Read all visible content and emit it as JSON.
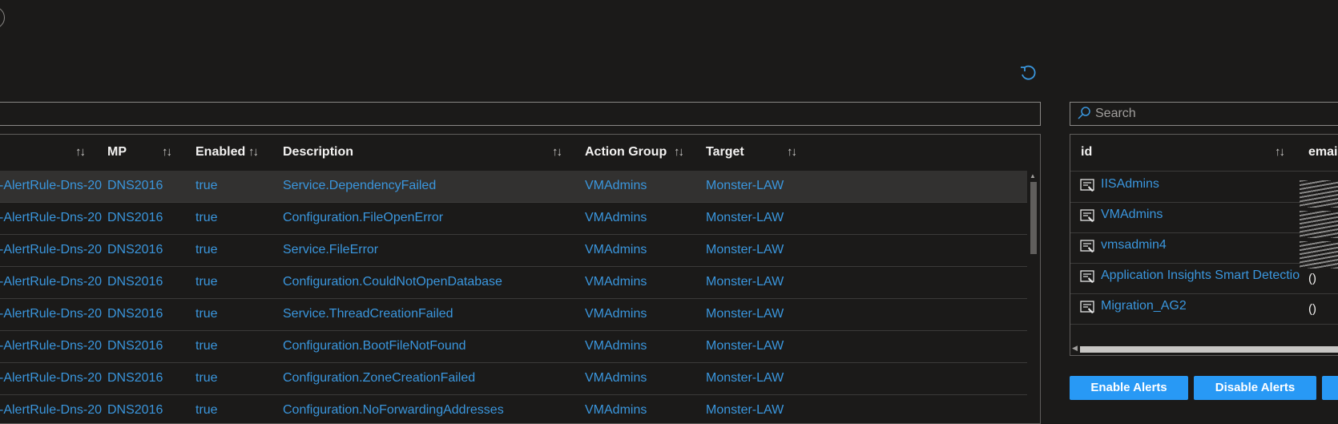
{
  "left_table": {
    "columns": [
      "",
      "MP",
      "Enabled",
      "Description",
      "Action Group",
      "Target"
    ],
    "rows": [
      {
        "name": "-AlertRule-Dns-20",
        "mp": "DNS2016",
        "enabled": "true",
        "description": "Service.DependencyFailed",
        "action_group": "VMAdmins",
        "target": "Monster-LAW"
      },
      {
        "name": "-AlertRule-Dns-20",
        "mp": "DNS2016",
        "enabled": "true",
        "description": "Configuration.FileOpenError",
        "action_group": "VMAdmins",
        "target": "Monster-LAW"
      },
      {
        "name": "-AlertRule-Dns-20",
        "mp": "DNS2016",
        "enabled": "true",
        "description": "Service.FileError",
        "action_group": "VMAdmins",
        "target": "Monster-LAW"
      },
      {
        "name": "-AlertRule-Dns-20",
        "mp": "DNS2016",
        "enabled": "true",
        "description": "Configuration.CouldNotOpenDatabase",
        "action_group": "VMAdmins",
        "target": "Monster-LAW"
      },
      {
        "name": "-AlertRule-Dns-20",
        "mp": "DNS2016",
        "enabled": "true",
        "description": "Service.ThreadCreationFailed",
        "action_group": "VMAdmins",
        "target": "Monster-LAW"
      },
      {
        "name": "-AlertRule-Dns-20",
        "mp": "DNS2016",
        "enabled": "true",
        "description": "Configuration.BootFileNotFound",
        "action_group": "VMAdmins",
        "target": "Monster-LAW"
      },
      {
        "name": "-AlertRule-Dns-20",
        "mp": "DNS2016",
        "enabled": "true",
        "description": "Configuration.ZoneCreationFailed",
        "action_group": "VMAdmins",
        "target": "Monster-LAW"
      },
      {
        "name": "-AlertRule-Dns-20",
        "mp": "DNS2016",
        "enabled": "true",
        "description": "Configuration.NoForwardingAddresses",
        "action_group": "VMAdmins",
        "target": "Monster-LAW"
      }
    ]
  },
  "right_panel": {
    "search_placeholder": "Search",
    "columns": [
      "id",
      "email"
    ],
    "rows": [
      {
        "id": "IISAdmins",
        "email": ""
      },
      {
        "id": "VMAdmins",
        "email": ""
      },
      {
        "id": "vmsadmin4",
        "email": ""
      },
      {
        "id": "Application Insights Smart Detectio",
        "email": "()"
      },
      {
        "id": "Migration_AG2",
        "email": "()"
      }
    ]
  },
  "buttons": {
    "enable": "Enable Alerts",
    "disable": "Disable Alerts"
  },
  "icons": [
    "refresh-icon",
    "search-icon",
    "action-group-icon",
    "sort-icon"
  ],
  "colors": {
    "background": "#1b1a19",
    "link": "#3a96dd",
    "button": "#2899f5",
    "selected_row": "#323130"
  }
}
